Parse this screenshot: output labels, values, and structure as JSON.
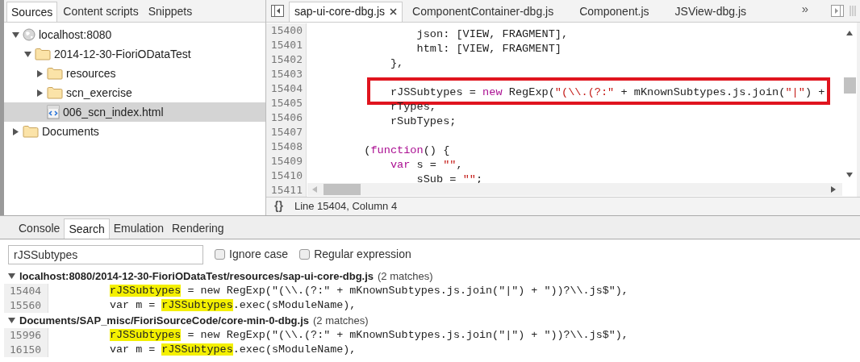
{
  "navigator": {
    "tabs": [
      {
        "label": "Sources",
        "selected": true
      },
      {
        "label": "Content scripts",
        "selected": false
      },
      {
        "label": "Snippets",
        "selected": false
      }
    ],
    "tree": [
      {
        "label": "localhost:8080",
        "kind": "host",
        "expanded": true,
        "selected": false,
        "children": [
          {
            "label": "2014-12-30-FioriODataTest",
            "kind": "folder",
            "expanded": true,
            "selected": false,
            "children": [
              {
                "label": "resources",
                "kind": "folder",
                "expanded": false,
                "selected": false
              },
              {
                "label": "scn_exercise",
                "kind": "folder",
                "expanded": false,
                "selected": false
              },
              {
                "label": "006_scn_index.html",
                "kind": "file",
                "selected": true
              }
            ]
          }
        ]
      },
      {
        "label": "Documents",
        "kind": "folder",
        "expanded": false,
        "selected": false
      }
    ]
  },
  "editor": {
    "tabs": [
      {
        "label": "sap-ui-core-dbg.js",
        "selected": true,
        "closable": true
      },
      {
        "label": "ComponentContainer-dbg.js",
        "selected": false,
        "closable": false
      },
      {
        "label": "Component.js",
        "selected": false,
        "closable": false
      },
      {
        "label": "JSView-dbg.js",
        "selected": false,
        "closable": false
      }
    ],
    "overflow": "»",
    "lines": [
      {
        "number": "15400",
        "boxed": false,
        "tokens": [
          {
            "kind": "plain",
            "text": "                json: [VIEW, FRAGMENT],"
          }
        ]
      },
      {
        "number": "15401",
        "boxed": false,
        "tokens": [
          {
            "kind": "plain",
            "text": "                html: [VIEW, FRAGMENT]"
          }
        ]
      },
      {
        "number": "15402",
        "boxed": false,
        "tokens": [
          {
            "kind": "plain",
            "text": "            },"
          }
        ]
      },
      {
        "number": "15403",
        "boxed": false
      },
      {
        "number": "15404",
        "boxed": true,
        "tokens": [
          {
            "kind": "plain",
            "text": "            rJSSubtypes = "
          },
          {
            "kind": "keyword",
            "text": "new"
          },
          {
            "kind": "plain",
            "text": " RegExp("
          },
          {
            "kind": "string",
            "text": "\"(\\\\.(?:\""
          },
          {
            "kind": "plain",
            "text": " + mKnownSubtypes.js.join("
          },
          {
            "kind": "string",
            "text": "\"|\""
          },
          {
            "kind": "plain",
            "text": ") +"
          }
        ]
      },
      {
        "number": "15405",
        "boxed": false,
        "tokens": [
          {
            "kind": "plain",
            "text": "            rTypes,"
          }
        ]
      },
      {
        "number": "15406",
        "boxed": false,
        "tokens": [
          {
            "kind": "plain",
            "text": "            rSubTypes;"
          }
        ]
      },
      {
        "number": "15407",
        "boxed": false
      },
      {
        "number": "15408",
        "boxed": false,
        "tokens": [
          {
            "kind": "plain",
            "text": "        ("
          },
          {
            "kind": "keyword",
            "text": "function"
          },
          {
            "kind": "plain",
            "text": "() {"
          }
        ]
      },
      {
        "number": "15409",
        "boxed": false,
        "tokens": [
          {
            "kind": "keyword",
            "text": "            var"
          },
          {
            "kind": "plain",
            "text": " s = "
          },
          {
            "kind": "string",
            "text": "\"\""
          },
          {
            "kind": "plain",
            "text": ","
          }
        ]
      },
      {
        "number": "15410",
        "boxed": false,
        "tokens": [
          {
            "kind": "plain",
            "text": "                sSub = "
          },
          {
            "kind": "string",
            "text": "\"\""
          },
          {
            "kind": "plain",
            "text": ";"
          }
        ]
      },
      {
        "number": "15411",
        "boxed": false
      }
    ],
    "status_bar": {
      "button": "{}",
      "text": "Line 15404, Column 4"
    }
  },
  "drawer": {
    "tabs": [
      {
        "label": "Console",
        "selected": false
      },
      {
        "label": "Search",
        "selected": true
      },
      {
        "label": "Emulation",
        "selected": false
      },
      {
        "label": "Rendering",
        "selected": false
      }
    ],
    "search": {
      "value": "rJSSubtypes",
      "options": [
        {
          "label": "Ignore case",
          "checked": false
        },
        {
          "label": "Regular expression",
          "checked": false
        }
      ]
    },
    "results": [
      {
        "file": "localhost:8080/2014-12-30-FioriODataTest/resources/sap-ui-core-dbg.js",
        "count": "(2 matches)",
        "expanded": true,
        "matches": [
          {
            "line": "15404",
            "segments": [
              {
                "text": "rJSSubtypes",
                "match": true
              },
              {
                "text": " = new RegExp(\"(\\\\.(?:\" + mKnownSubtypes.js.join(\"|\") + \"))?\\\\.js$\"),",
                "match": false
              }
            ]
          },
          {
            "line": "15560",
            "segments": [
              {
                "text": "var m = ",
                "match": false
              },
              {
                "text": "rJSSubtypes",
                "match": true
              },
              {
                "text": ".exec(sModuleName),",
                "match": false
              }
            ]
          }
        ]
      },
      {
        "file": "Documents/SAP_misc/FioriSourceCode/core-min-0-dbg.js",
        "count": "(2 matches)",
        "expanded": true,
        "matches": [
          {
            "line": "15996",
            "segments": [
              {
                "text": "rJSSubtypes",
                "match": true
              },
              {
                "text": " = new RegExp(\"(\\\\.(?:\" + mKnownSubtypes.js.join(\"|\") + \"))?\\\\.js$\"),",
                "match": false
              }
            ]
          },
          {
            "line": "16150",
            "segments": [
              {
                "text": "var m = ",
                "match": false
              },
              {
                "text": "rJSSubtypes",
                "match": true
              },
              {
                "text": ".exec(sModuleName),",
                "match": false
              }
            ]
          }
        ]
      }
    ]
  }
}
